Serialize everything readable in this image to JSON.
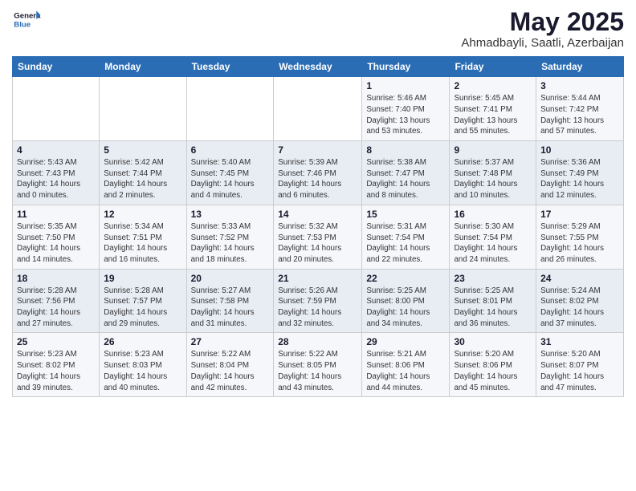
{
  "header": {
    "logo_text_general": "General",
    "logo_text_blue": "Blue",
    "main_title": "May 2025",
    "sub_title": "Ahmadbayli, Saatli, Azerbaijan"
  },
  "calendar": {
    "days_of_week": [
      "Sunday",
      "Monday",
      "Tuesday",
      "Wednesday",
      "Thursday",
      "Friday",
      "Saturday"
    ],
    "weeks": [
      [
        {
          "day": "",
          "info": ""
        },
        {
          "day": "",
          "info": ""
        },
        {
          "day": "",
          "info": ""
        },
        {
          "day": "",
          "info": ""
        },
        {
          "day": "1",
          "info": "Sunrise: 5:46 AM\nSunset: 7:40 PM\nDaylight: 13 hours\nand 53 minutes."
        },
        {
          "day": "2",
          "info": "Sunrise: 5:45 AM\nSunset: 7:41 PM\nDaylight: 13 hours\nand 55 minutes."
        },
        {
          "day": "3",
          "info": "Sunrise: 5:44 AM\nSunset: 7:42 PM\nDaylight: 13 hours\nand 57 minutes."
        }
      ],
      [
        {
          "day": "4",
          "info": "Sunrise: 5:43 AM\nSunset: 7:43 PM\nDaylight: 14 hours\nand 0 minutes."
        },
        {
          "day": "5",
          "info": "Sunrise: 5:42 AM\nSunset: 7:44 PM\nDaylight: 14 hours\nand 2 minutes."
        },
        {
          "day": "6",
          "info": "Sunrise: 5:40 AM\nSunset: 7:45 PM\nDaylight: 14 hours\nand 4 minutes."
        },
        {
          "day": "7",
          "info": "Sunrise: 5:39 AM\nSunset: 7:46 PM\nDaylight: 14 hours\nand 6 minutes."
        },
        {
          "day": "8",
          "info": "Sunrise: 5:38 AM\nSunset: 7:47 PM\nDaylight: 14 hours\nand 8 minutes."
        },
        {
          "day": "9",
          "info": "Sunrise: 5:37 AM\nSunset: 7:48 PM\nDaylight: 14 hours\nand 10 minutes."
        },
        {
          "day": "10",
          "info": "Sunrise: 5:36 AM\nSunset: 7:49 PM\nDaylight: 14 hours\nand 12 minutes."
        }
      ],
      [
        {
          "day": "11",
          "info": "Sunrise: 5:35 AM\nSunset: 7:50 PM\nDaylight: 14 hours\nand 14 minutes."
        },
        {
          "day": "12",
          "info": "Sunrise: 5:34 AM\nSunset: 7:51 PM\nDaylight: 14 hours\nand 16 minutes."
        },
        {
          "day": "13",
          "info": "Sunrise: 5:33 AM\nSunset: 7:52 PM\nDaylight: 14 hours\nand 18 minutes."
        },
        {
          "day": "14",
          "info": "Sunrise: 5:32 AM\nSunset: 7:53 PM\nDaylight: 14 hours\nand 20 minutes."
        },
        {
          "day": "15",
          "info": "Sunrise: 5:31 AM\nSunset: 7:54 PM\nDaylight: 14 hours\nand 22 minutes."
        },
        {
          "day": "16",
          "info": "Sunrise: 5:30 AM\nSunset: 7:54 PM\nDaylight: 14 hours\nand 24 minutes."
        },
        {
          "day": "17",
          "info": "Sunrise: 5:29 AM\nSunset: 7:55 PM\nDaylight: 14 hours\nand 26 minutes."
        }
      ],
      [
        {
          "day": "18",
          "info": "Sunrise: 5:28 AM\nSunset: 7:56 PM\nDaylight: 14 hours\nand 27 minutes."
        },
        {
          "day": "19",
          "info": "Sunrise: 5:28 AM\nSunset: 7:57 PM\nDaylight: 14 hours\nand 29 minutes."
        },
        {
          "day": "20",
          "info": "Sunrise: 5:27 AM\nSunset: 7:58 PM\nDaylight: 14 hours\nand 31 minutes."
        },
        {
          "day": "21",
          "info": "Sunrise: 5:26 AM\nSunset: 7:59 PM\nDaylight: 14 hours\nand 32 minutes."
        },
        {
          "day": "22",
          "info": "Sunrise: 5:25 AM\nSunset: 8:00 PM\nDaylight: 14 hours\nand 34 minutes."
        },
        {
          "day": "23",
          "info": "Sunrise: 5:25 AM\nSunset: 8:01 PM\nDaylight: 14 hours\nand 36 minutes."
        },
        {
          "day": "24",
          "info": "Sunrise: 5:24 AM\nSunset: 8:02 PM\nDaylight: 14 hours\nand 37 minutes."
        }
      ],
      [
        {
          "day": "25",
          "info": "Sunrise: 5:23 AM\nSunset: 8:02 PM\nDaylight: 14 hours\nand 39 minutes."
        },
        {
          "day": "26",
          "info": "Sunrise: 5:23 AM\nSunset: 8:03 PM\nDaylight: 14 hours\nand 40 minutes."
        },
        {
          "day": "27",
          "info": "Sunrise: 5:22 AM\nSunset: 8:04 PM\nDaylight: 14 hours\nand 42 minutes."
        },
        {
          "day": "28",
          "info": "Sunrise: 5:22 AM\nSunset: 8:05 PM\nDaylight: 14 hours\nand 43 minutes."
        },
        {
          "day": "29",
          "info": "Sunrise: 5:21 AM\nSunset: 8:06 PM\nDaylight: 14 hours\nand 44 minutes."
        },
        {
          "day": "30",
          "info": "Sunrise: 5:20 AM\nSunset: 8:06 PM\nDaylight: 14 hours\nand 45 minutes."
        },
        {
          "day": "31",
          "info": "Sunrise: 5:20 AM\nSunset: 8:07 PM\nDaylight: 14 hours\nand 47 minutes."
        }
      ]
    ]
  }
}
